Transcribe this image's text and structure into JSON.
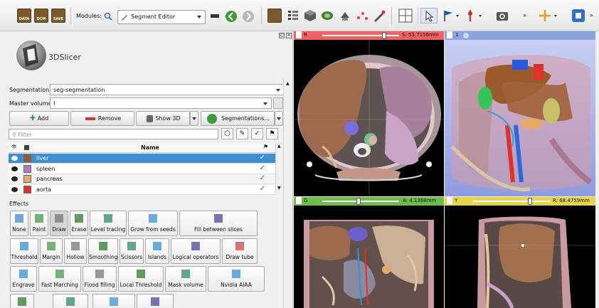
{
  "toolbar": {
    "data_icon": "DATA",
    "dcm_icon": "DCM",
    "save_icon": "SAVE",
    "modules_label": "Modules:",
    "module_selected": "Segment Editor"
  },
  "logo": {
    "text": "3DSlicer"
  },
  "segmentation": {
    "label": "Segmentation:",
    "value": "seg-segmentation"
  },
  "master_volume": {
    "label": "Master volume:",
    "value": "I"
  },
  "buttons": {
    "add": "Add",
    "remove": "Remove",
    "show3d": "Show 3D",
    "segmentations": "Segmentations..."
  },
  "filter": {
    "placeholder": "Filter"
  },
  "table": {
    "header_name": "Name",
    "rows": [
      {
        "name": "liver",
        "color": "#9a5a2c",
        "selected": true
      },
      {
        "name": "spleen",
        "color": "#b07ac0",
        "selected": false
      },
      {
        "name": "pancreas",
        "color": "#e6a96a",
        "selected": false
      },
      {
        "name": "aorta",
        "color": "#e0302a",
        "selected": false
      }
    ]
  },
  "effects": {
    "title": "Effects",
    "row1": [
      "None",
      "Paint",
      "Draw",
      "Erase",
      "Level tracing",
      "Grow from seeds",
      "Fill between slices"
    ],
    "row2": [
      "Threshold",
      "Margin",
      "Hollow",
      "Smoothing",
      "Scissors",
      "Islands",
      "Logical operators",
      "Draw tube"
    ],
    "row3": [
      "Engrave",
      "Fast Marching",
      "Flood filling",
      "Local Threshold",
      "Mask volume",
      "Nvidia AIAA"
    ]
  },
  "views": {
    "red": {
      "letter": "R",
      "readout": "S: 53.7156mm"
    },
    "threed": {
      "letter": "1"
    },
    "green": {
      "letter": "G",
      "readout": "A: 4.1368mm"
    },
    "yellow": {
      "letter": "Y",
      "readout": "R: 68.4759mm"
    }
  },
  "colors": {
    "red_view": "#f06262",
    "green_view": "#6dbb4a",
    "yellow_view": "#e8d44a",
    "threed_view": "#8aa4e0",
    "selection": "#3d8fd1"
  }
}
